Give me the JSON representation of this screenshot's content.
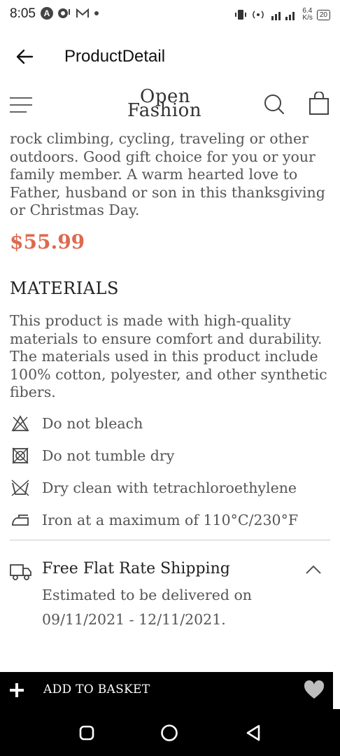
{
  "status_bar": {
    "time": "8:05",
    "net_speed": "6.4",
    "net_unit": "K/s",
    "network": "4G",
    "battery": "20"
  },
  "app_bar": {
    "title": "ProductDetail"
  },
  "header": {
    "logo_line1": "Open",
    "logo_line2": "Fashion"
  },
  "product": {
    "description": "rock climbing, cycling, traveling or other outdoors. Good gift choice for you or your family member. A warm hearted love to Father, husband or son in this thanksgiving or Christmas Day.",
    "price": "$55.99",
    "price_color": "#dd6a4f"
  },
  "materials": {
    "title": "MATERIALS",
    "text": "This product is made with high-quality materials to ensure comfort and durability. The materials used in this product include 100% cotton, polyester, and other synthetic fibers.",
    "care": [
      {
        "icon": "no-bleach-icon",
        "label": "Do not bleach"
      },
      {
        "icon": "no-tumble-dry-icon",
        "label": "Do not tumble dry"
      },
      {
        "icon": "dry-clean-icon",
        "label": "Dry clean with tetrachloroethylene"
      },
      {
        "icon": "iron-icon",
        "label": "Iron at a maximum of 110°C/230°F"
      }
    ]
  },
  "shipping": {
    "title": "Free Flat Rate Shipping",
    "line1": "Estimated to be delivered on",
    "line2": "09/11/2021 - 12/11/2021."
  },
  "basket": {
    "label": "ADD TO BASKET"
  }
}
